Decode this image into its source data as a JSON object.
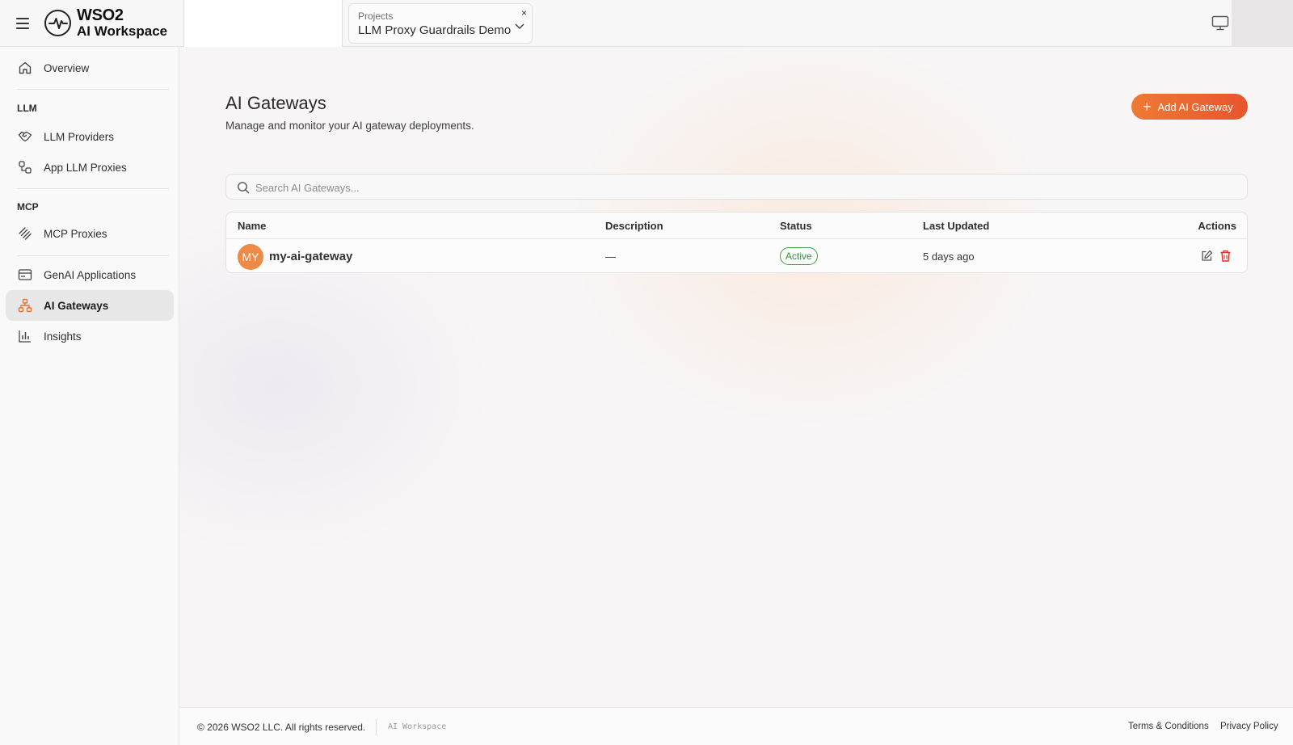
{
  "brand": {
    "line1": "WSO2",
    "line2": "AI Workspace",
    "accent": "#e8542e"
  },
  "header": {
    "project_label": "Projects",
    "project_value": "LLM Proxy Guardrails Demo",
    "clear_symbol": "×"
  },
  "sidebar": {
    "overview": "Overview",
    "llm_section": "LLM",
    "llm_providers": "LLM Providers",
    "app_llm_proxies": "App LLM Proxies",
    "mcp_section": "MCP",
    "mcp_proxies": "MCP Proxies",
    "genai_applications": "GenAI Applications",
    "ai_gateways": "AI Gateways",
    "insights": "Insights",
    "active_item": "AI Gateways"
  },
  "main": {
    "title": "AI Gateways",
    "subtitle": "Manage and monitor your AI gateway deployments.",
    "add_button": "Add AI Gateway",
    "search_placeholder": "Search AI Gateways...",
    "columns": {
      "name": "Name",
      "description": "Description",
      "status": "Status",
      "last_updated": "Last Updated",
      "actions": "Actions"
    },
    "rows": [
      {
        "initials": "MY",
        "name": "my-ai-gateway",
        "description": "—",
        "status": "Active",
        "last_updated": "5 days ago"
      }
    ]
  },
  "footer": {
    "copyright": "© 2026 WSO2 LLC. All rights reserved.",
    "product": "AI Workspace",
    "terms": "Terms & Conditions",
    "privacy": "Privacy Policy"
  }
}
